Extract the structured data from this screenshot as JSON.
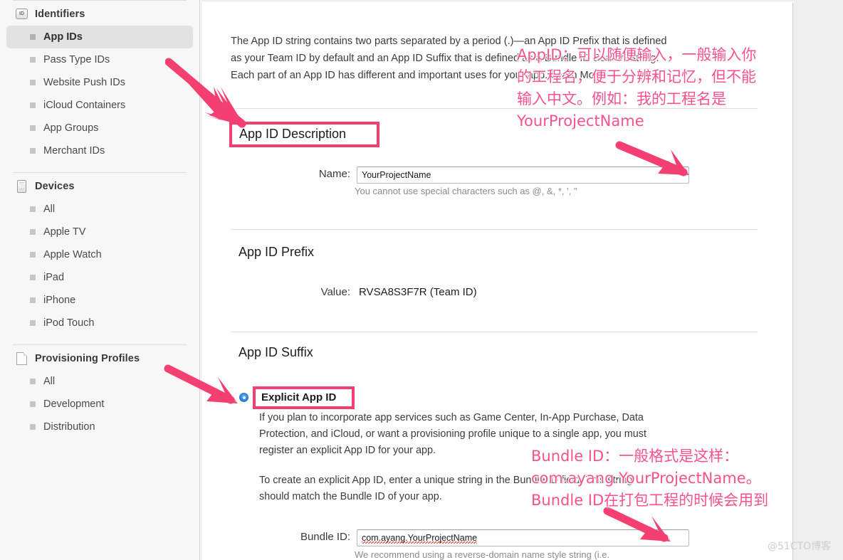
{
  "sidebar": {
    "groups": [
      {
        "label": "Identifiers",
        "icon": "id-badge-icon",
        "badge_text": "ID",
        "items": [
          {
            "label": "App IDs",
            "selected": true
          },
          {
            "label": "Pass Type IDs",
            "selected": false
          },
          {
            "label": "Website Push IDs",
            "selected": false
          },
          {
            "label": "iCloud Containers",
            "selected": false
          },
          {
            "label": "App Groups",
            "selected": false
          },
          {
            "label": "Merchant IDs",
            "selected": false
          }
        ]
      },
      {
        "label": "Devices",
        "icon": "device-icon",
        "items": [
          {
            "label": "All",
            "selected": false
          },
          {
            "label": "Apple TV",
            "selected": false
          },
          {
            "label": "Apple Watch",
            "selected": false
          },
          {
            "label": "iPad",
            "selected": false
          },
          {
            "label": "iPhone",
            "selected": false
          },
          {
            "label": "iPod Touch",
            "selected": false
          }
        ]
      },
      {
        "label": "Provisioning Profiles",
        "icon": "document-icon",
        "items": [
          {
            "label": "All",
            "selected": false
          },
          {
            "label": "Development",
            "selected": false
          },
          {
            "label": "Distribution",
            "selected": false
          }
        ]
      }
    ]
  },
  "main": {
    "intro_line1": "The App ID string contains two parts separated by a period (.)—an App ID Prefix that is defined",
    "intro_line2": "as your Team ID by default and an App ID Suffix that is defined as a Bundle ID Search String.",
    "intro_line3": "Each part of an App ID has different and important uses for your app. Learn More",
    "app_id_description": {
      "title": "App ID Description",
      "name_label": "Name:",
      "name_value": "YourProjectName",
      "name_hint": "You cannot use special characters such as @, &, *, ', \""
    },
    "app_id_prefix": {
      "title": "App ID Prefix",
      "value_label": "Value:",
      "value": "RVSA8S3F7R (Team ID)"
    },
    "app_id_suffix": {
      "title": "App ID Suffix",
      "explicit_label": "Explicit App ID",
      "explicit_selected": true,
      "explicit_p1_line1": "If you plan to incorporate app services such as Game Center, In-App Purchase, Data",
      "explicit_p1_line2": "Protection, and iCloud, or want a provisioning profile unique to a single app, you must",
      "explicit_p1_line3": "register an explicit App ID for your app.",
      "explicit_p2_line1": "To create an explicit App ID, enter a unique string in the Bundle ID field. This string",
      "explicit_p2_line2": "should match the Bundle ID of your app.",
      "bundle_id_label": "Bundle ID:",
      "bundle_id_value": "com.ayang.YourProjectName",
      "bundle_id_hint": "We recommend using a reverse-domain name style string (i.e."
    }
  },
  "annotations": {
    "appid_note": "AppID：可以随便输入，一般输入你\n的工程名，便于分辨和记忆，但不能\n输入中文。例如：我的工程名是\nYourProjectName",
    "bundleid_note": "Bundle ID：一般格式是这样：\ncom.ayang.YourProjectName。\nBundle ID在打包工程的时候会用到"
  },
  "watermark": "@51CTO博客",
  "colors": {
    "accent_pink": "#f43f73",
    "anno_pink": "#f8528a",
    "radio_blue": "#2e86de",
    "sidebar_bg": "#f7f7f7",
    "selected_bg": "#e2e2e2"
  }
}
